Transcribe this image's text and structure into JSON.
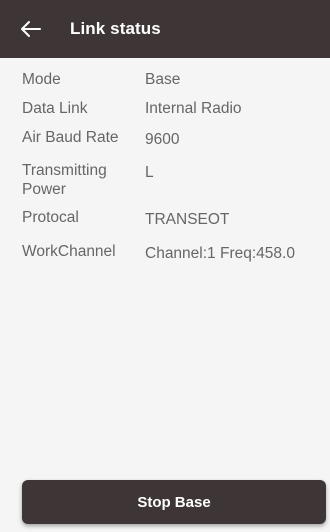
{
  "header": {
    "title": "Link status",
    "back_icon": "arrow-left-icon"
  },
  "fields": [
    {
      "label": "Mode",
      "value": "Base"
    },
    {
      "label": "Data Link",
      "value": "Internal Radio"
    },
    {
      "label": "Air Baud Rate",
      "value": "9600"
    },
    {
      "label": "Transmitting Power",
      "value": "L"
    },
    {
      "label": "Protocal",
      "value": "TRANSEOT"
    },
    {
      "label": "WorkChannel",
      "value": "Channel:1 Freq:458.0"
    }
  ],
  "actions": {
    "stop_label": "Stop Base"
  },
  "colors": {
    "bar": "#3e3636",
    "background": "#f5f5f5",
    "text": "#666666"
  }
}
